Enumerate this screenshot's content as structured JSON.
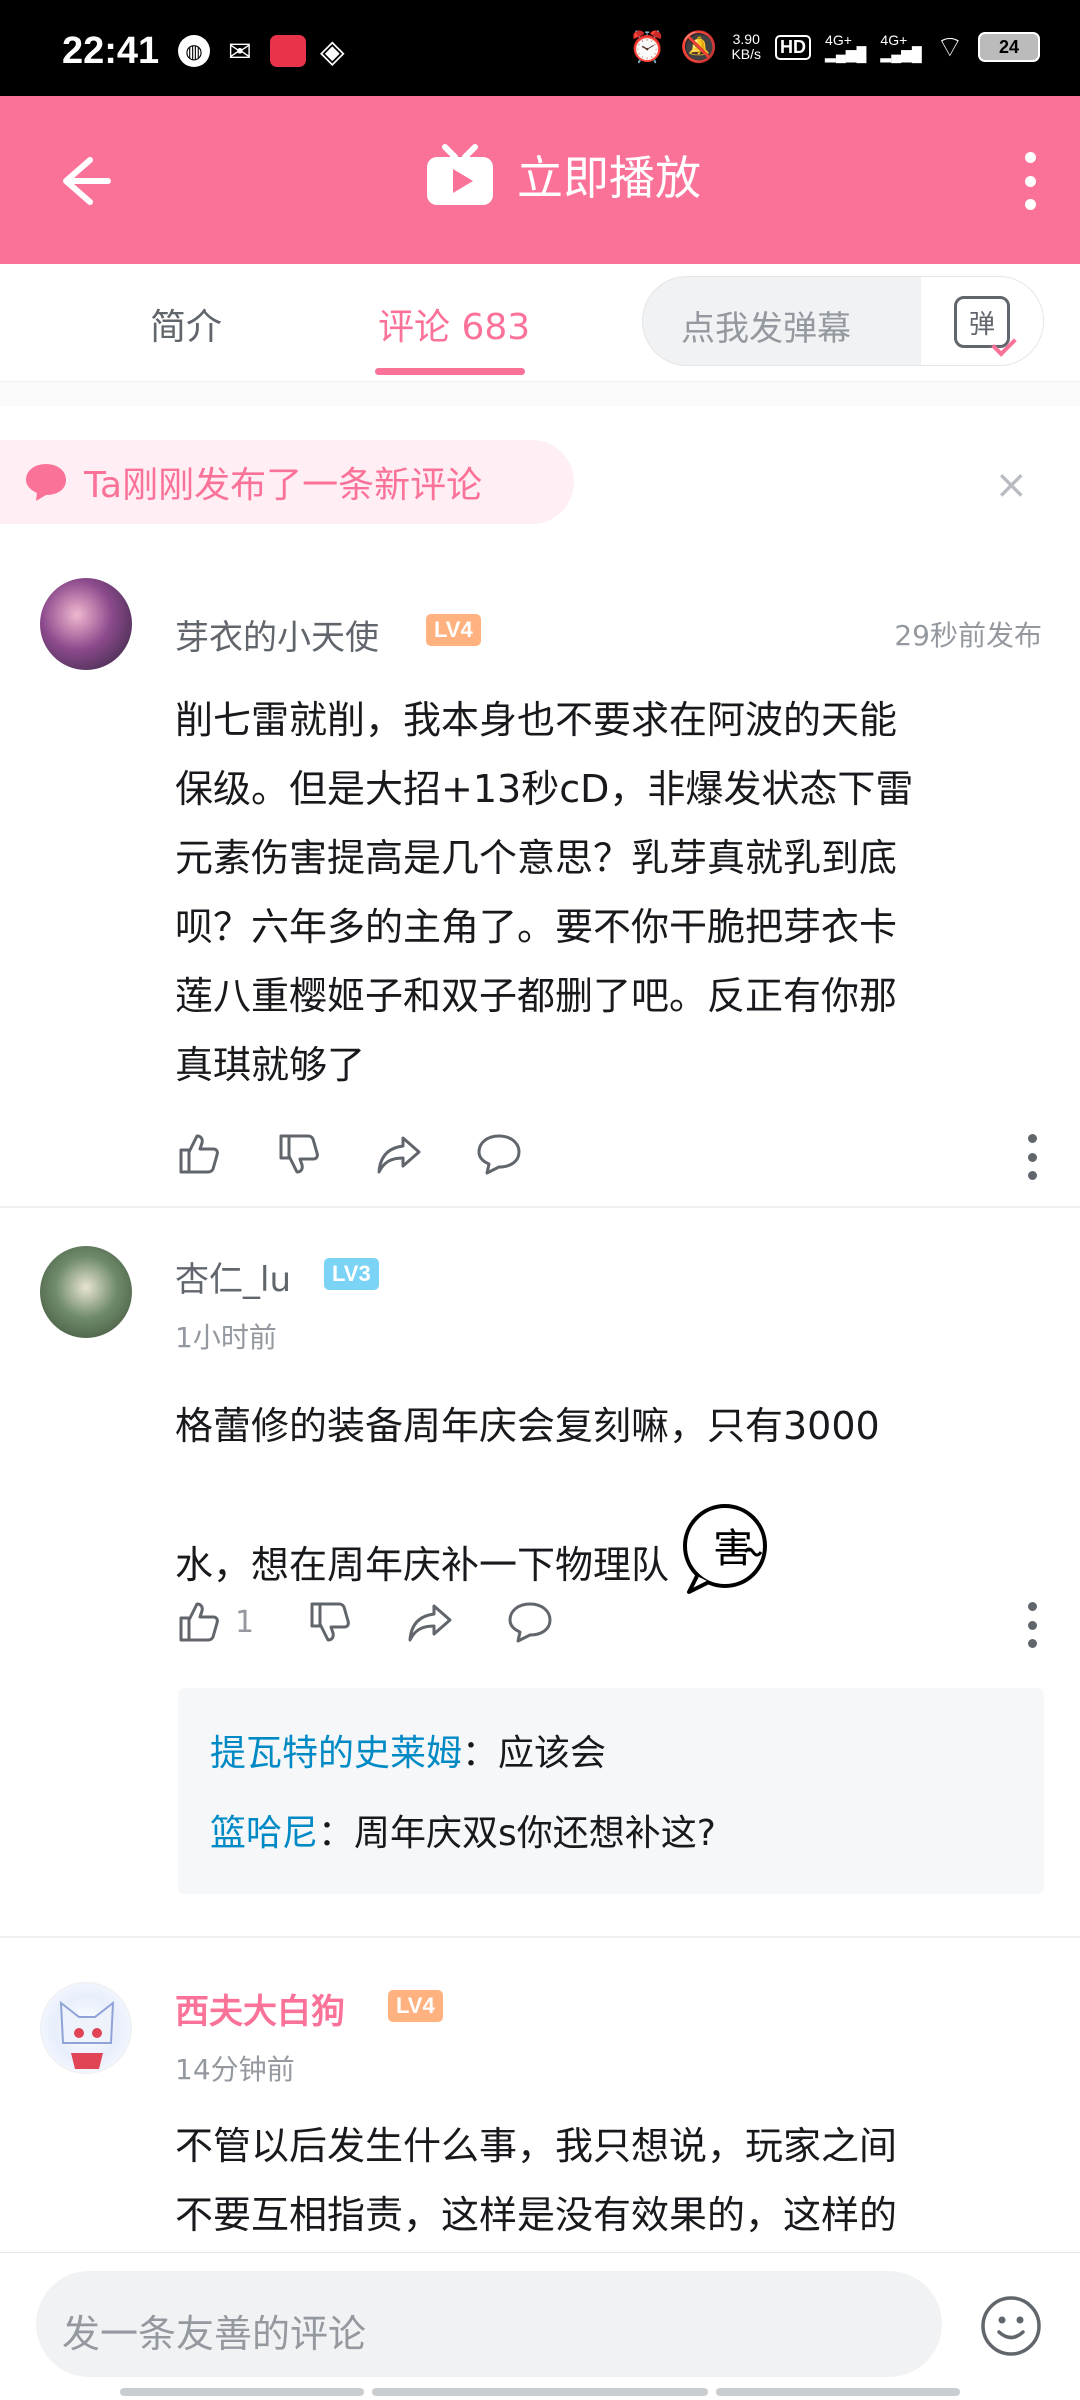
{
  "status_bar": {
    "time": "22:41",
    "speed_value": "3.90",
    "speed_unit": "KB/s",
    "hd": "HD",
    "signal1": "4G+",
    "signal2": "4G+",
    "battery": "24"
  },
  "header": {
    "title": "立即播放"
  },
  "tabs": {
    "intro": "简介",
    "comments": "评论 683",
    "danmaku_placeholder": "点我发弹幕",
    "danmaku_btn": "弹"
  },
  "notice": {
    "text": "Ta刚刚发布了一条新评论",
    "close": "×"
  },
  "comments": [
    {
      "user": "芽衣的小天使",
      "level": "LV4",
      "time": "29秒前发布",
      "lines": [
        "削七雷就削，我本身也不要求在阿波的天能",
        "保级。但是大招+13秒cD，非爆发状态下雷",
        "元素伤害提高是几个意思？乳芽真就乳到底",
        "呗？六年多的主角了。要不你干脆把芽衣卡",
        "莲八重樱姬子和双子都删了吧。反正有你那",
        "真琪就够了"
      ],
      "likes": ""
    },
    {
      "user": "杏仁_lu",
      "level": "LV3",
      "time": "1小时前",
      "line1": "格蕾修的装备周年庆会复刻嘛，只有3000",
      "line2": "水，想在周年庆补一下物理队",
      "sticker_text": "害",
      "likes": "1",
      "replies": [
        {
          "user": "提瓦特的史莱姆",
          "text": "：应该会"
        },
        {
          "user": "篮哈尼",
          "text": "：周年庆双s你还想补这?"
        }
      ]
    },
    {
      "user": "西夫大白狗",
      "level": "LV4",
      "time": "14分钟前",
      "lines": [
        "不管以后发生什么事，我只想说，玩家之间",
        "不要互相指责，这样是没有效果的，这样的"
      ]
    }
  ],
  "bottom": {
    "placeholder": "发一条友善的评论"
  },
  "colors": {
    "brand_pink": "#fb7299",
    "reply_blue": "#008ac5",
    "lv4": "#ffb27f",
    "lv3": "#7bd3f5"
  }
}
